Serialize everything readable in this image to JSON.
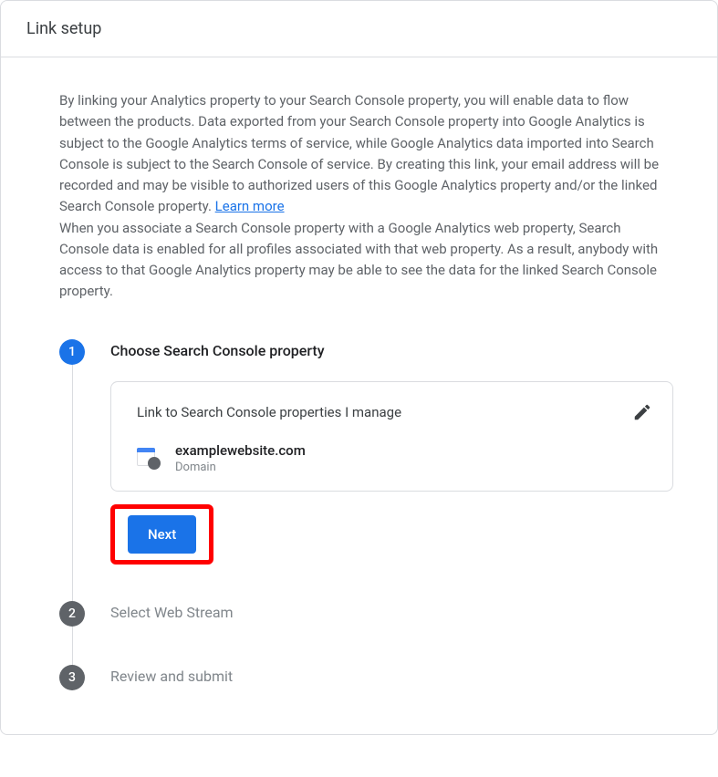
{
  "header": {
    "title": "Link setup"
  },
  "description": {
    "text1": "By linking your Analytics property to your Search Console property, you will enable data to flow between the products. Data exported from your Search Console property into Google Analytics is subject to the Google Analytics terms of service, while Google Analytics data imported into Search Console is subject to the Search Console of service. By creating this link, your email address will be recorded and may be visible to authorized users of this Google Analytics property and/or the linked Search Console property. ",
    "learn_more": "Learn more",
    "text2": "When you associate a Search Console property with a Google Analytics web property, Search Console data is enabled for all profiles associated with that web property. As a result, anybody with access to that Google Analytics property may be able to see the data for the linked Search Console property."
  },
  "steps": {
    "step1": {
      "number": "1",
      "title": "Choose Search Console property",
      "box_title": "Link to Search Console properties I manage",
      "property_name": "examplewebsite.com",
      "property_type": "Domain",
      "next_label": "Next"
    },
    "step2": {
      "number": "2",
      "title": "Select Web Stream"
    },
    "step3": {
      "number": "3",
      "title": "Review and submit"
    }
  }
}
